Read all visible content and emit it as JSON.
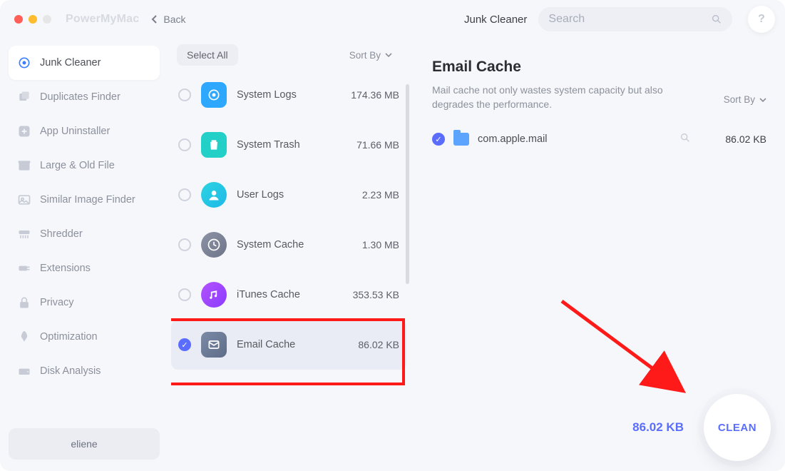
{
  "app_title": "PowerMyMac",
  "back_label": "Back",
  "header": {
    "breadcrumb": "Junk Cleaner",
    "search_placeholder": "Search",
    "help_label": "?"
  },
  "sidebar": {
    "items": [
      {
        "label": "Junk Cleaner"
      },
      {
        "label": "Duplicates Finder"
      },
      {
        "label": "App Uninstaller"
      },
      {
        "label": "Large & Old File"
      },
      {
        "label": "Similar Image Finder"
      },
      {
        "label": "Shredder"
      },
      {
        "label": "Extensions"
      },
      {
        "label": "Privacy"
      },
      {
        "label": "Optimization"
      },
      {
        "label": "Disk Analysis"
      }
    ],
    "user": "eliene"
  },
  "mid": {
    "select_all": "Select All",
    "sort_by": "Sort By",
    "items": [
      {
        "name": "System Logs",
        "size": "174.36 MB"
      },
      {
        "name": "System Trash",
        "size": "71.66 MB"
      },
      {
        "name": "User Logs",
        "size": "2.23 MB"
      },
      {
        "name": "System Cache",
        "size": "1.30 MB"
      },
      {
        "name": "iTunes Cache",
        "size": "353.53 KB"
      },
      {
        "name": "Email Cache",
        "size": "86.02 KB"
      }
    ]
  },
  "detail": {
    "title": "Email Cache",
    "description": "Mail cache not only wastes system capacity but also degrades the performance.",
    "sort_by": "Sort By",
    "items": [
      {
        "name": "com.apple.mail",
        "size": "86.02 KB"
      }
    ],
    "total_size": "86.02 KB",
    "clean_label": "CLEAN"
  }
}
